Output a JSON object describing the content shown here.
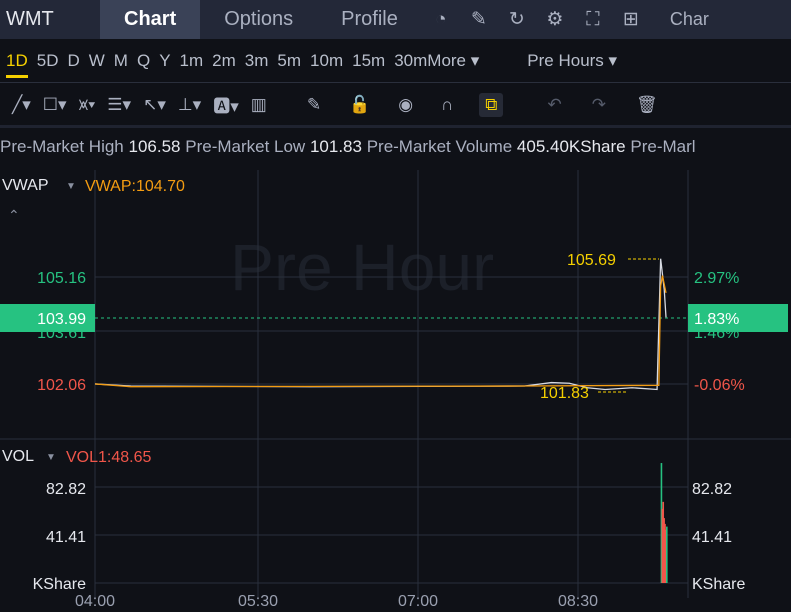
{
  "header": {
    "symbol": "WMT",
    "tabs": [
      "Chart",
      "Options",
      "Profile"
    ],
    "active_tab": "Chart",
    "icons": [
      "gauge-icon",
      "edit-icon",
      "refresh-icon",
      "gear-icon",
      "fullscreen-icon",
      "grid-icon"
    ],
    "trailing": "Char"
  },
  "timeframes": {
    "items": [
      "1D",
      "5D",
      "D",
      "W",
      "M",
      "Q",
      "Y",
      "1m",
      "2m",
      "3m",
      "5m",
      "10m",
      "15m",
      "30m"
    ],
    "active": "1D",
    "more": "More ▾",
    "session": "Pre Hours ▾"
  },
  "tools": [
    "line-tool-icon",
    "rect-tool-icon",
    "pattern-tool-icon",
    "fib-tool-icon",
    "arrow-tool-icon",
    "measure-tool-icon",
    "text-tool-icon",
    "indicator-icon",
    "pencil-icon",
    "unlock-icon",
    "eye-icon",
    "magnet-icon",
    "link-icon",
    "undo-icon",
    "redo-icon",
    "trash-icon"
  ],
  "info": {
    "high_label": "Pre-Market High",
    "high": "106.58",
    "low_label": "Pre-Market Low",
    "low": "101.83",
    "vol_label": "Pre-Market Volume",
    "vol": "405.40KShare",
    "trail": "Pre-Marl"
  },
  "price": {
    "indicator": "VWAP",
    "indicator_value": "VWAP:104.70",
    "watermark": "Pre Hour",
    "left_ticks": [
      "105.16",
      "103.61",
      "102.06"
    ],
    "right_ticks": [
      "2.97%",
      "1.46%",
      "-0.06%"
    ],
    "current": "103.99",
    "current_pct": "1.83%",
    "max_label": "105.69",
    "min_label": "101.83"
  },
  "volume": {
    "indicator": "VOL",
    "indicator_value": "VOL1:48.65",
    "ticks": [
      "82.82",
      "41.41",
      "KShare"
    ]
  },
  "xaxis": [
    "04:00",
    "05:30",
    "07:00",
    "08:30"
  ],
  "colors": {
    "up": "#26c281",
    "down": "#f0564a",
    "accent": "#f5d000",
    "vwap": "#f39c12"
  },
  "chart_data": {
    "type": "line",
    "x_range": [
      "04:00",
      "09:20"
    ],
    "price": [
      [
        "04:00",
        102.06
      ],
      [
        "04:20",
        102.0
      ],
      [
        "06:00",
        101.98
      ],
      [
        "08:00",
        102.0
      ],
      [
        "08:15",
        102.1
      ],
      [
        "08:25",
        102.08
      ],
      [
        "08:35",
        101.95
      ],
      [
        "08:45",
        101.9
      ],
      [
        "09:00",
        101.95
      ],
      [
        "09:14",
        101.9
      ],
      [
        "09:16",
        105.69
      ],
      [
        "09:18",
        104.8
      ],
      [
        "09:19",
        103.99
      ]
    ],
    "vwap": [
      [
        "04:00",
        102.06
      ],
      [
        "04:20",
        101.98
      ],
      [
        "08:00",
        102.0
      ],
      [
        "09:15",
        102.02
      ],
      [
        "09:16",
        104.9
      ],
      [
        "09:17",
        105.2
      ],
      [
        "09:19",
        104.7
      ]
    ],
    "volume": [
      [
        "09:16",
        103.5,
        "up"
      ],
      [
        "09:16.5",
        64,
        "down"
      ],
      [
        "09:17",
        70,
        "down"
      ],
      [
        "09:17.5",
        56,
        "down"
      ],
      [
        "09:18",
        51,
        "down"
      ],
      [
        "09:18.5",
        46,
        "down"
      ],
      [
        "09:19",
        48.65,
        "up"
      ]
    ]
  }
}
